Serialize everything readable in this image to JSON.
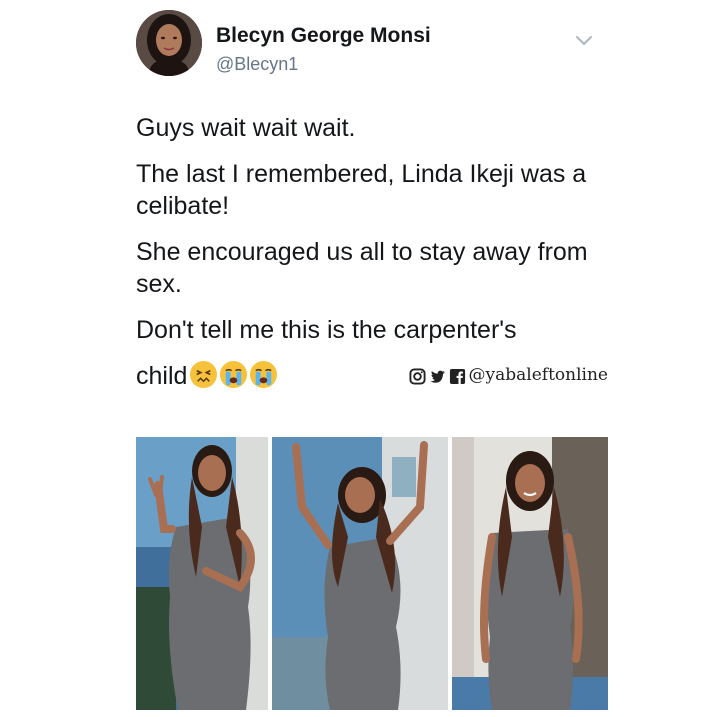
{
  "tweet": {
    "author": {
      "name": "Blecyn George Monsi",
      "handle": "@Blecyn1"
    },
    "paragraphs": [
      "Guys wait wait wait.",
      "The last I remembered, Linda Ikeji was a celibate!",
      "She encouraged us all to stay away from sex.",
      "Don't tell me this is the carpenter's"
    ],
    "last_word": "child",
    "emojis": [
      "persevering-face-emoji",
      "crying-face-emoji",
      "crying-face-emoji"
    ]
  },
  "watermark": {
    "handle": "@yabaleftonline",
    "icons": [
      "instagram-icon",
      "twitter-icon",
      "facebook-icon"
    ]
  },
  "photos": [
    {
      "name": "photo-peace-sign"
    },
    {
      "name": "photo-arms-raised"
    },
    {
      "name": "photo-smiling"
    }
  ],
  "colors": {
    "name": "#14171a",
    "handle": "#657786",
    "dress": "#6b6d70",
    "sky": "#5b8fb8"
  }
}
